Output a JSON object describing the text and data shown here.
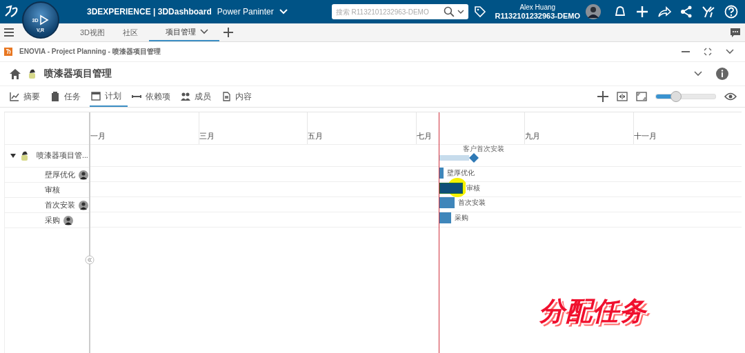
{
  "topbar": {
    "brand": "3DEXPERIENCE | 3DDashboard",
    "dashboard": "Power Paninter",
    "compass_labels": [
      "3D",
      "V,R"
    ],
    "search": {
      "placeholder": "搜索 R1132101232963-DEMO"
    },
    "user": "Alex Huang",
    "tenant": "R1132101232963-DEMO"
  },
  "dashboard_tabs": [
    {
      "label": "3D视图",
      "selected": false
    },
    {
      "label": "社区",
      "selected": false
    },
    {
      "label": "项目管理",
      "selected": true
    }
  ],
  "app_title": "ENOVIA - Project Planning - 喷漆器项目管理",
  "project_title": "喷漆器项目管理",
  "view_tabs": [
    {
      "label": "摘要",
      "selected": false
    },
    {
      "label": "任务",
      "selected": false
    },
    {
      "label": "计划",
      "selected": true
    },
    {
      "label": "依赖项",
      "selected": false
    },
    {
      "label": "成员",
      "selected": false
    },
    {
      "label": "内容",
      "selected": false
    }
  ],
  "zoom_slider": {
    "level": 0.34
  },
  "months": [
    "一月",
    "三月",
    "五月",
    "七月",
    "九月",
    "十一月"
  ],
  "project_row": {
    "name": "喷漆器项目管...",
    "expanded": true,
    "milestone_label": "客户首次安装"
  },
  "tasks": [
    {
      "name": "壁厚优化",
      "avatar": true,
      "bar_label": "壁厚优化",
      "selected": false
    },
    {
      "name": "审核",
      "avatar": false,
      "bar_label": "审核",
      "selected": true
    },
    {
      "name": "首次安装",
      "avatar": true,
      "bar_label": "首次安装",
      "selected": false
    },
    {
      "name": "采购",
      "avatar": true,
      "bar_label": "采购",
      "selected": false
    }
  ],
  "caption": "分配任务"
}
